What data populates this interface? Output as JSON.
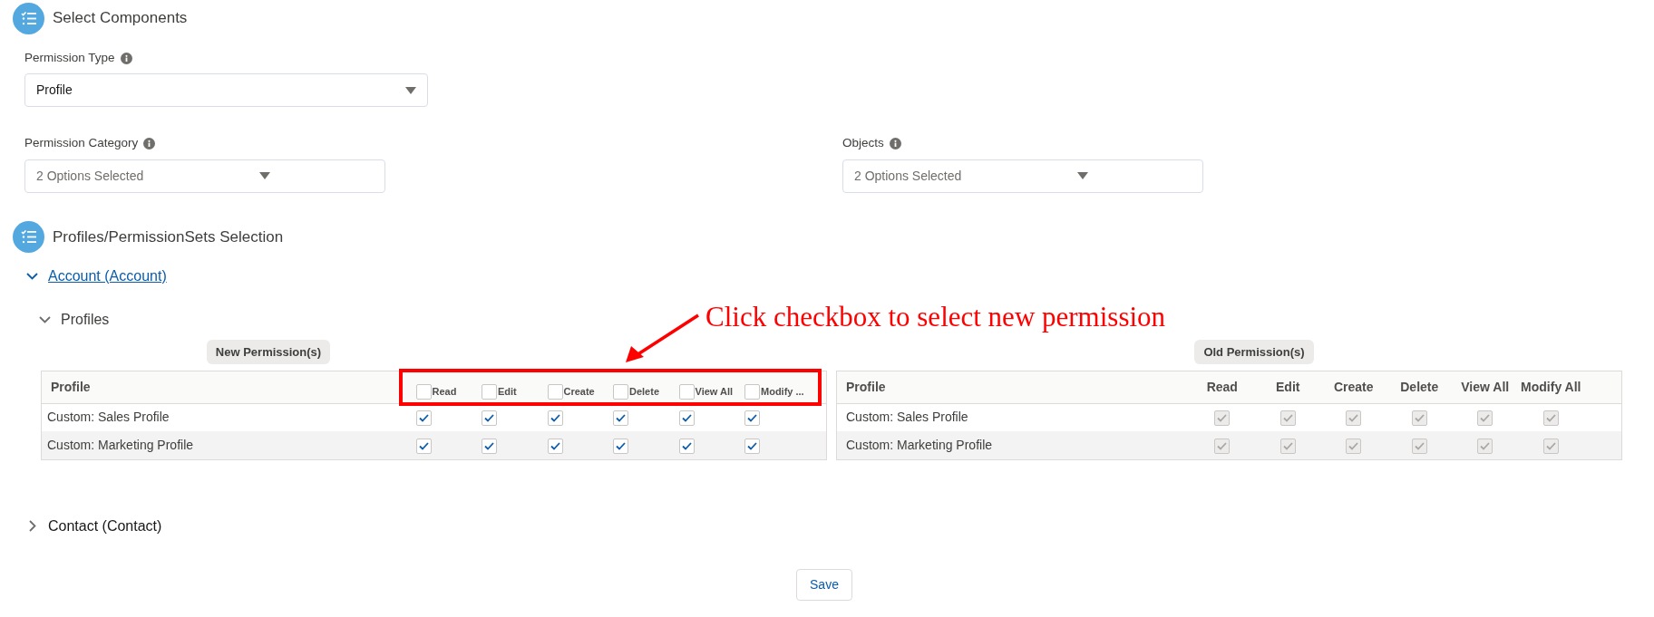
{
  "select_components": {
    "title": "Select Components",
    "fields": [
      {
        "label": "Permission Type",
        "value": "Profile",
        "kind": "picklist"
      },
      {
        "label": "Permission Category",
        "value": "2 Options Selected",
        "kind": "multiselect"
      },
      {
        "label": "Objects",
        "value": "2 Options Selected",
        "kind": "multiselect"
      }
    ]
  },
  "selection": {
    "title": "Profiles/PermissionSets Selection",
    "objects": [
      {
        "label": "Account (Account)",
        "expanded": true,
        "groups": [
          {
            "label": "Profiles",
            "expanded": true,
            "annotation": "Click checkbox to select new permission",
            "tables": [
              {
                "badge": "New Permission(s)",
                "kind": "new",
                "disabled": false,
                "header": "Profile",
                "columns": [
                  {
                    "label": "Read",
                    "checked": false
                  },
                  {
                    "label": "Edit",
                    "checked": false
                  },
                  {
                    "label": "Create",
                    "checked": false
                  },
                  {
                    "label": "Delete",
                    "checked": false
                  },
                  {
                    "label": "View All",
                    "checked": false
                  },
                  {
                    "label": "Modify ...",
                    "checked": false
                  }
                ],
                "rows": [
                  {
                    "profile": "Custom: Sales Profile",
                    "checks": [
                      true,
                      true,
                      true,
                      true,
                      true,
                      true
                    ]
                  },
                  {
                    "profile": "Custom: Marketing Profile",
                    "checks": [
                      true,
                      true,
                      true,
                      true,
                      true,
                      true
                    ]
                  }
                ]
              },
              {
                "badge": "Old Permission(s)",
                "kind": "old",
                "disabled": true,
                "header": "Profile",
                "columns": [
                  {
                    "label": "Read"
                  },
                  {
                    "label": "Edit"
                  },
                  {
                    "label": "Create"
                  },
                  {
                    "label": "Delete"
                  },
                  {
                    "label": "View All"
                  },
                  {
                    "label": "Modify All"
                  }
                ],
                "rows": [
                  {
                    "profile": "Custom: Sales Profile",
                    "checks": [
                      true,
                      true,
                      true,
                      true,
                      true,
                      true
                    ]
                  },
                  {
                    "profile": "Custom: Marketing Profile",
                    "checks": [
                      true,
                      true,
                      true,
                      true,
                      true,
                      true
                    ]
                  }
                ]
              }
            ]
          }
        ]
      },
      {
        "label": "Contact (Contact)",
        "expanded": false
      }
    ]
  },
  "save_button": "Save"
}
